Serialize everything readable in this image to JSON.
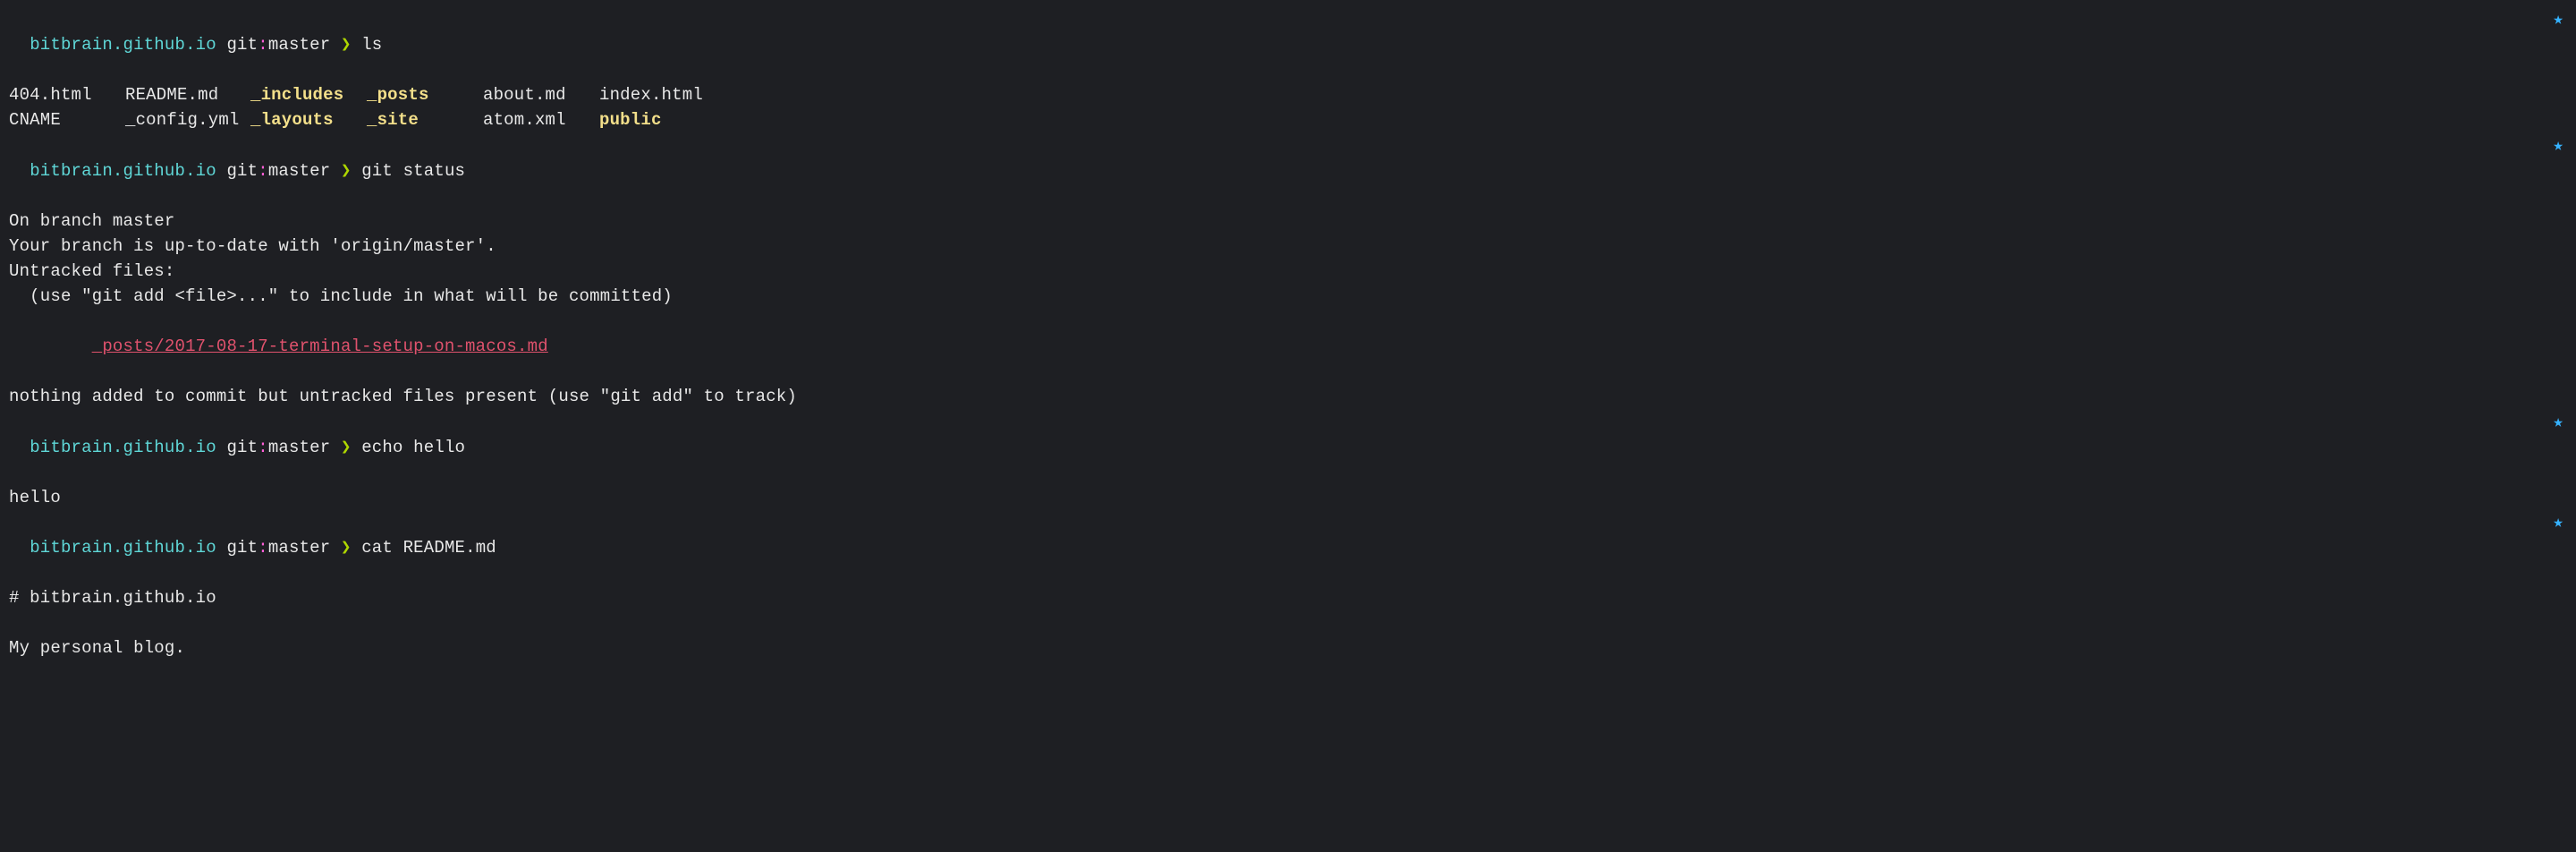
{
  "prompt": {
    "directory": "bitbrain.github.io",
    "git_label": "git",
    "colon": ":",
    "branch": "master",
    "arrow": "❯",
    "star": "★"
  },
  "commands": {
    "c1": "ls",
    "c2": "git status",
    "c3": "echo hello",
    "c4": "cat README.md"
  },
  "ls_output": {
    "row1": {
      "c1": "404.html",
      "c2": "README.md",
      "c3": "_includes",
      "c4": "_posts",
      "c5": "about.md",
      "c6": "index.html"
    },
    "row2": {
      "c1": "CNAME",
      "c2": "_config.yml",
      "c3": "_layouts",
      "c4": "_site",
      "c5": "atom.xml",
      "c6": "public"
    }
  },
  "git_status": {
    "l1": "On branch master",
    "l2": "Your branch is up-to-date with 'origin/master'.",
    "l3": "Untracked files:",
    "l4": "  (use \"git add <file>...\" to include in what will be committed)",
    "untracked_indent": "        ",
    "untracked_file": "_posts/2017-08-17-terminal-setup-on-macos.md",
    "l5": "nothing added to commit but untracked files present (use \"git add\" to track)"
  },
  "echo_output": "hello",
  "readme": {
    "l1": "# bitbrain.github.io",
    "l2": "My personal blog."
  }
}
